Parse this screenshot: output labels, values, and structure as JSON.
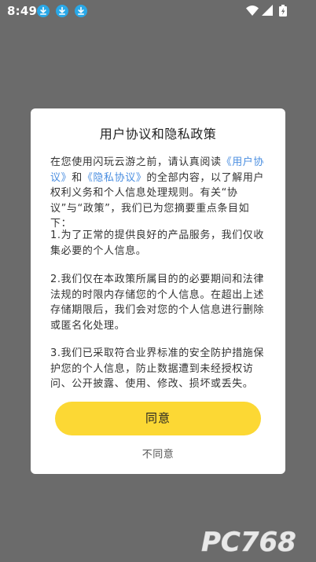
{
  "status_bar": {
    "time": "8:49",
    "notification_icons": [
      "download-icon",
      "download-icon",
      "download-icon"
    ],
    "system_icons": [
      "wifi-icon",
      "signal-icon",
      "battery-icon"
    ]
  },
  "dialog": {
    "title": "用户协议和隐私政策",
    "intro": {
      "part1": "在您使用闪玩云游之前，请认真阅读",
      "link1": "《用户协议》",
      "part2": "和",
      "link2": "《隐私协议》",
      "part3": "的全部内容，以了解用户权利义务和个人信息处理规则。有关“协议”与“政策”，我们已为您摘要重点条目如下："
    },
    "items": [
      "1.为了正常的提供良好的产品服务，我们仅收集必要的个人信息。",
      "2.我们仅在本政策所属目的的必要期间和法律法规的时限内存储您的个人信息。在超出上述存储期限后，我们会对您的个人信息进行删除或匿名化处理。",
      "3.我们已采取符合业界标准的安全防护措施保护您的个人信息，防止数据遭到未经授权访问、公开披露、使用、修改、损坏或丢失。"
    ],
    "agree_label": "同意",
    "disagree_label": "不同意"
  },
  "watermark": {
    "text": "PC768"
  },
  "colors": {
    "overlay": "#6b6b6b",
    "accent_button": "#fcd834",
    "link": "#4a8ee0",
    "download_icon": "#29a8e8"
  }
}
